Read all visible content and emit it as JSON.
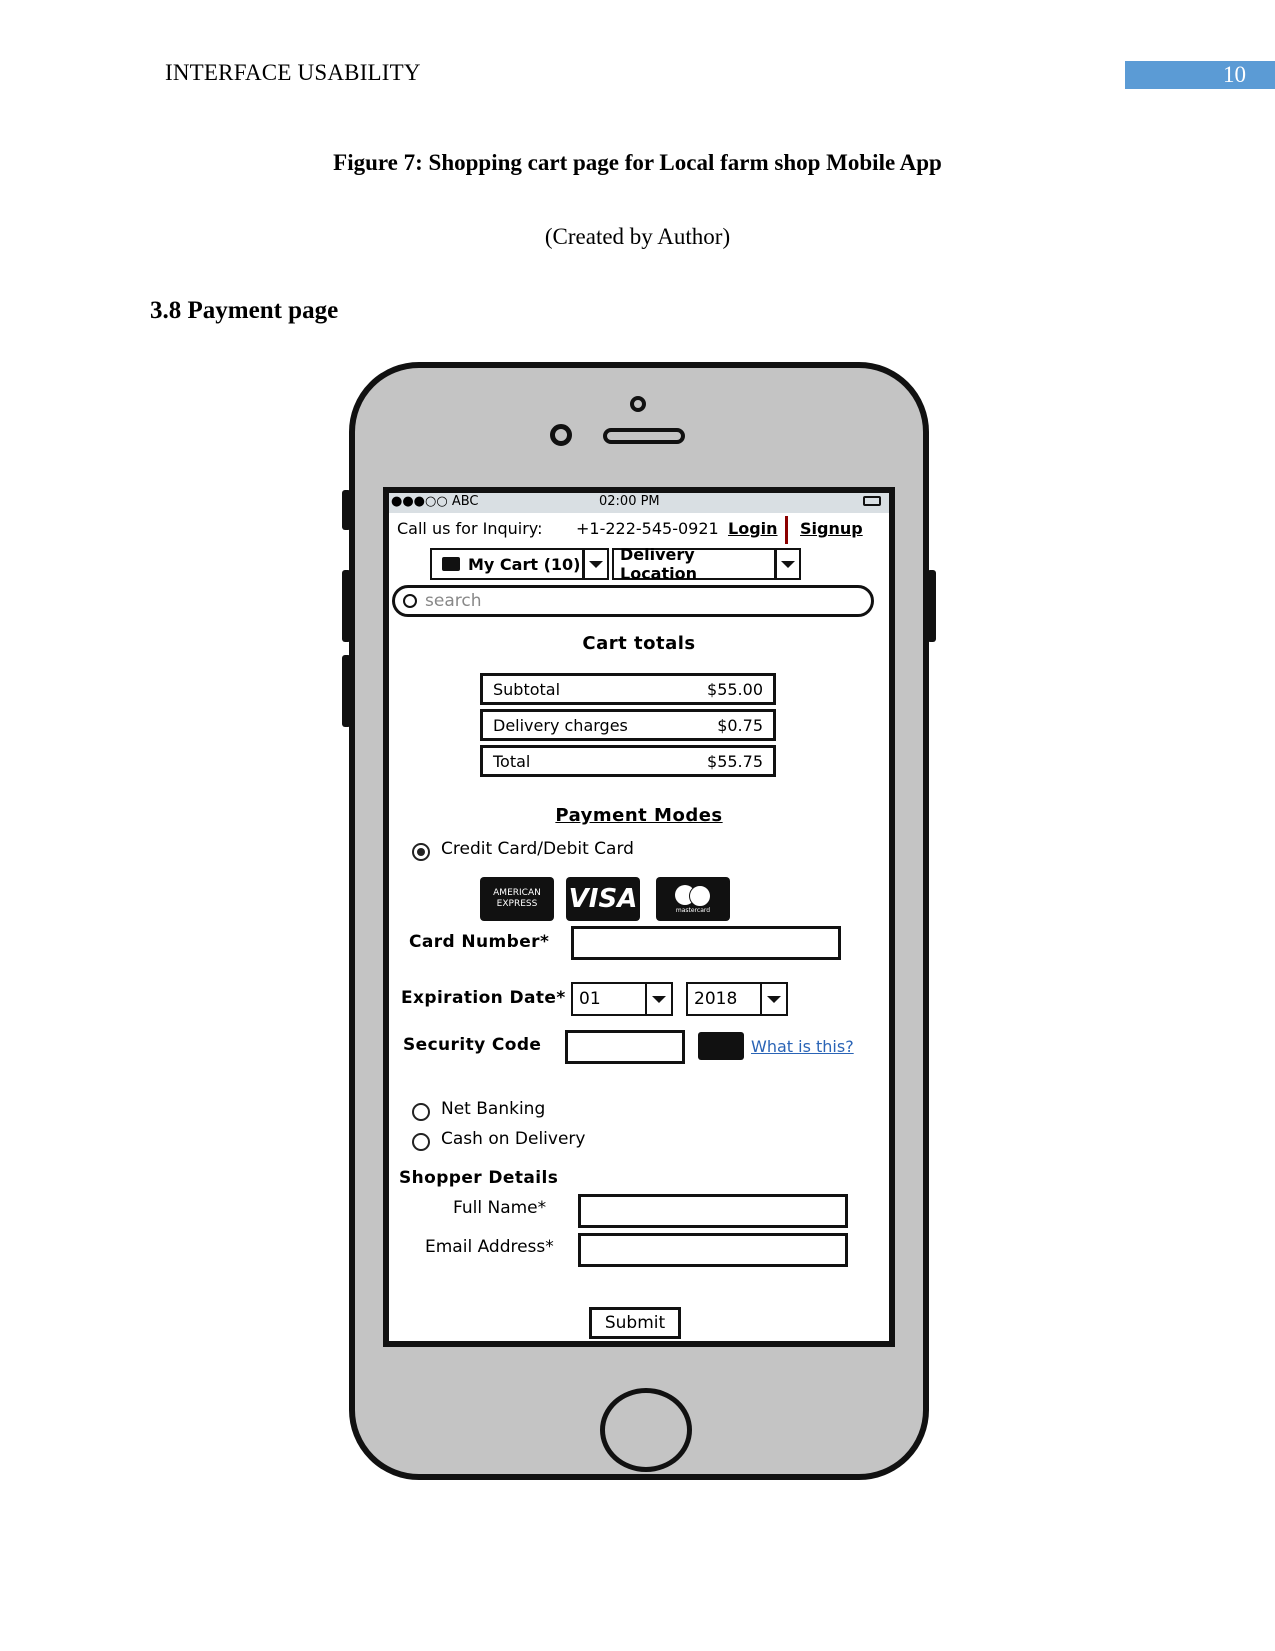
{
  "document": {
    "running_head": "INTERFACE USABILITY",
    "page_number": "10",
    "figure_caption": "Figure 7: Shopping cart page for Local farm shop Mobile App",
    "figure_credit": "(Created by Author)",
    "section_heading": "3.8 Payment page"
  },
  "mockup": {
    "status_bar": {
      "carrier": "●●●○○ ABC",
      "time": "02:00 PM",
      "battery_icon": "battery-icon"
    },
    "header": {
      "inquiry_label": "Call us for Inquiry:",
      "phone": "+1-222-545-0921",
      "login": "Login",
      "signup": "Signup"
    },
    "toolbar": {
      "cart_label": "My Cart (10)",
      "cart_icon": "cart-icon",
      "delivery_label": "Delivery Location"
    },
    "search": {
      "placeholder": "search",
      "icon": "search-icon"
    },
    "cart_totals": {
      "title": "Cart totals",
      "rows": [
        {
          "label": "Subtotal",
          "value": "$55.00"
        },
        {
          "label": "Delivery charges",
          "value": "$0.75"
        },
        {
          "label": "Total",
          "value": "$55.75"
        }
      ]
    },
    "payment": {
      "title": "Payment Modes",
      "options": [
        {
          "label": "Credit Card/Debit Card",
          "selected": true
        },
        {
          "label": "Net Banking",
          "selected": false
        },
        {
          "label": "Cash on Delivery",
          "selected": false
        }
      ],
      "card_logos": {
        "amex_line1": "AMERICAN",
        "amex_line2": "EXPRESS",
        "visa": "VISA",
        "mastercard": "mastercard"
      },
      "card_number_label": "Card Number*",
      "card_number_value": "",
      "expiration_label": "Expiration Date*",
      "exp_month": "01",
      "exp_year": "2018",
      "security_label": "Security Code",
      "security_value": "",
      "what_is_this": "What is this?"
    },
    "shopper": {
      "title": "Shopper Details",
      "full_name_label": "Full Name*",
      "full_name_value": "",
      "email_label": "Email Address*",
      "email_value": ""
    },
    "submit_label": "Submit"
  }
}
